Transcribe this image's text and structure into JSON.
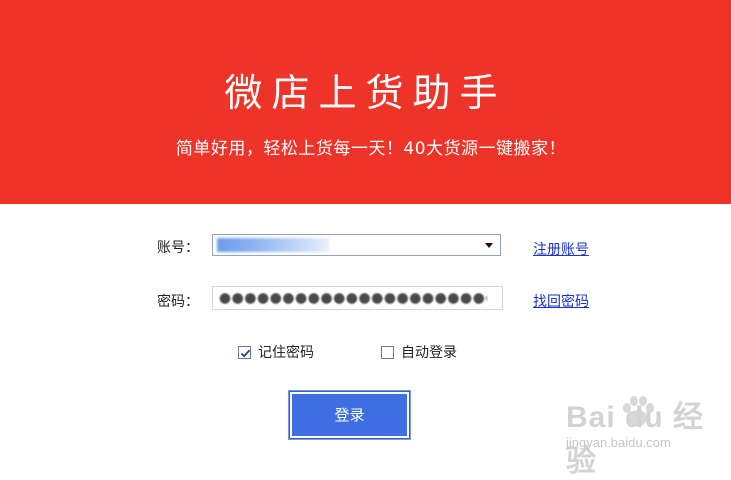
{
  "header": {
    "title": "微店上货助手",
    "subtitle": "简单好用，轻松上货每一天！40大货源一键搬家！",
    "background_color": "#ee3328"
  },
  "form": {
    "account_label": "账号：",
    "password_label": "密码：",
    "register_link": "注册账号",
    "recover_link": "找回密码",
    "remember_password": {
      "label": "记住密码",
      "checked": true
    },
    "auto_login": {
      "label": "自动登录",
      "checked": false
    },
    "login_button": "登录"
  },
  "colors": {
    "accent": "#3f6fe3",
    "link": "#1a33c8"
  },
  "watermark": {
    "main": "Bai du 经验",
    "sub": "jingyan.baidu.com"
  }
}
